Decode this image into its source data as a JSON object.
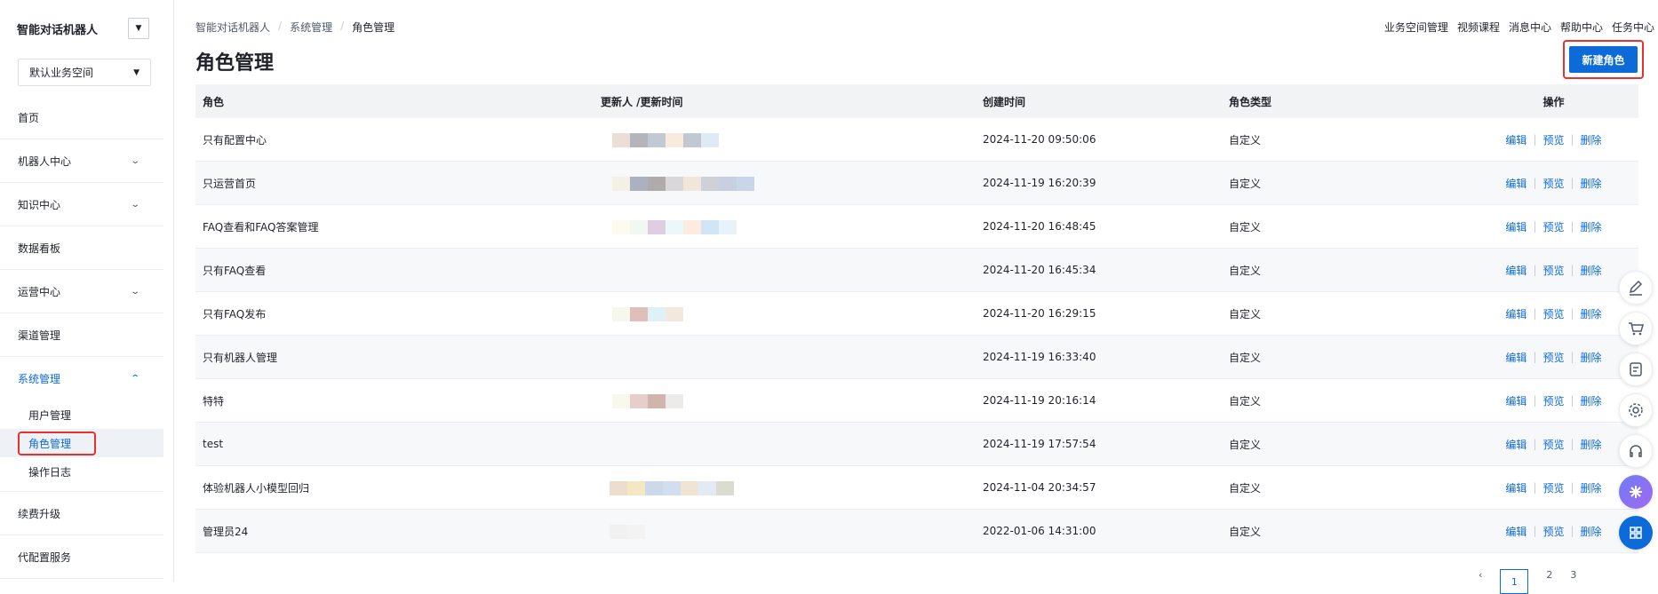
{
  "sidebar": {
    "app_title": "智能对话机器人",
    "workspace": "默认业务空间",
    "menu": [
      {
        "label": "首页"
      },
      {
        "label": "机器人中心"
      },
      {
        "label": "知识中心"
      },
      {
        "label": "数据看板"
      },
      {
        "label": "运营中心"
      },
      {
        "label": "渠道管理"
      },
      {
        "label": "系统管理"
      },
      {
        "label": "续费升级"
      },
      {
        "label": "代配置服务"
      }
    ],
    "submenu": [
      {
        "label": "用户管理"
      },
      {
        "label": "角色管理"
      },
      {
        "label": "操作日志"
      }
    ]
  },
  "breadcrumb": [
    "智能对话机器人",
    "系统管理",
    "角色管理"
  ],
  "topnav": [
    "业务空间管理",
    "视频课程",
    "消息中心",
    "帮助中心",
    "任务中心"
  ],
  "page_title": "角色管理",
  "new_button": "新建角色",
  "table": {
    "headers": [
      "角色",
      "更新人 /更新时间",
      "创建时间",
      "角色类型",
      "操作"
    ],
    "rows": [
      {
        "role": "只有配置中心",
        "created": "2024-11-20 09:50:06",
        "type": "自定义"
      },
      {
        "role": "只运营首页",
        "created": "2024-11-19 16:20:39",
        "type": "自定义"
      },
      {
        "role": "FAQ查看和FAQ答案管理",
        "created": "2024-11-20 16:48:45",
        "type": "自定义"
      },
      {
        "role": "只有FAQ查看",
        "created": "2024-11-20 16:45:34",
        "type": "自定义"
      },
      {
        "role": "只有FAQ发布",
        "created": "2024-11-20 16:29:15",
        "type": "自定义"
      },
      {
        "role": "只有机器人管理",
        "created": "2024-11-19 16:33:40",
        "type": "自定义"
      },
      {
        "role": "特特",
        "created": "2024-11-19 20:16:14",
        "type": "自定义"
      },
      {
        "role": "test",
        "created": "2024-11-19 17:57:54",
        "type": "自定义"
      },
      {
        "role": "体验机器人小模型回归",
        "created": "2024-11-04 20:34:57",
        "type": "自定义"
      },
      {
        "role": "管理员24",
        "created": "2022-01-06 14:31:00",
        "type": "自定义"
      }
    ],
    "ops": {
      "edit": "编辑",
      "preview": "预览",
      "delete": "删除"
    }
  },
  "pagination": {
    "pages": [
      "1",
      "2",
      "3"
    ],
    "current": "1"
  },
  "colors": {
    "primary": "#0c6ad9",
    "highlight": "#e5322e"
  },
  "tools": [
    "edit-icon",
    "cart-icon",
    "app-icon",
    "settings-icon",
    "headset-icon",
    "ai-assistant-icon",
    "grid-icon"
  ]
}
